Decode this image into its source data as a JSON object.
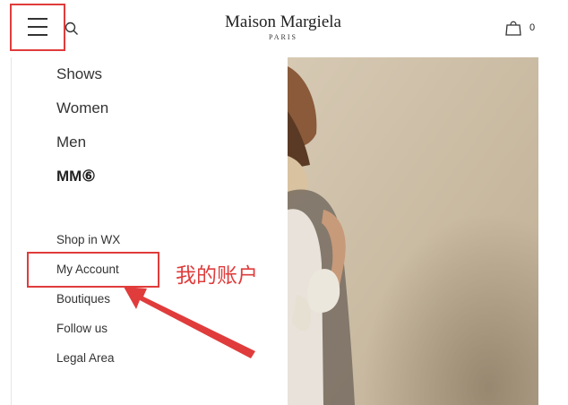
{
  "header": {
    "logo_main": "Maison Margiela",
    "logo_sub": "PARIS",
    "cart_count": "0",
    "icons": {
      "menu": "hamburger-icon",
      "search": "search-icon",
      "cart": "shopping-bag-icon"
    }
  },
  "menu": {
    "main_items": [
      {
        "label": "Shows"
      },
      {
        "label": "Women"
      },
      {
        "label": "Men"
      },
      {
        "label": "MM⑥"
      }
    ],
    "sub_items": [
      {
        "label": "Shop in WX"
      },
      {
        "label": "My Account"
      },
      {
        "label": "Boutiques"
      },
      {
        "label": "Follow us"
      },
      {
        "label": "Legal Area"
      }
    ]
  },
  "annotation": {
    "label": "我的账户",
    "color": "#e03c3c"
  },
  "colors": {
    "background": "#ffffff",
    "text": "#333333",
    "photo_wall": "#cdbfa8"
  }
}
